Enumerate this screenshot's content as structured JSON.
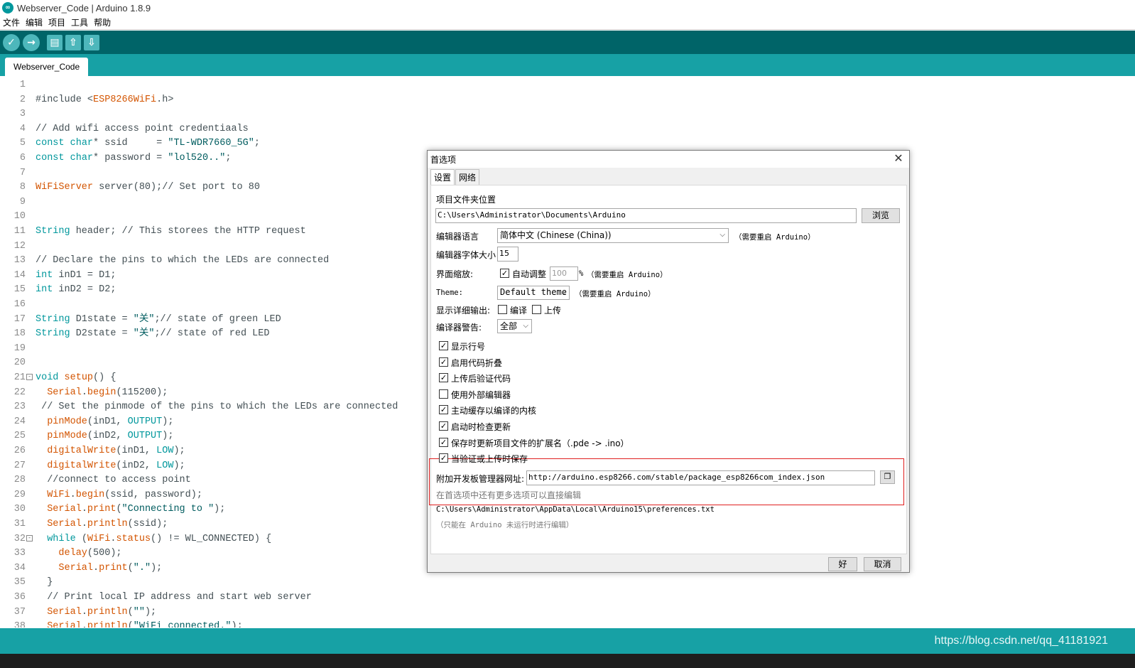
{
  "window": {
    "title": "Webserver_Code | Arduino 1.8.9",
    "icon": "arduino-logo-icon"
  },
  "menu": [
    "文件",
    "编辑",
    "项目",
    "工具",
    "帮助"
  ],
  "toolbar": {
    "buttons": [
      {
        "name": "verify-button",
        "icon": "check-icon",
        "glyph": "✓"
      },
      {
        "name": "upload-button",
        "icon": "arrow-right-icon",
        "glyph": "→"
      },
      {
        "name": "new-button",
        "icon": "file-icon",
        "glyph": "▤"
      },
      {
        "name": "open-button",
        "icon": "arrow-up-icon",
        "glyph": "⇧"
      },
      {
        "name": "save-button",
        "icon": "arrow-down-icon",
        "glyph": "⇩"
      }
    ]
  },
  "tab": {
    "label": "Webserver_Code"
  },
  "code_lines": [
    {
      "n": "1",
      "html": ""
    },
    {
      "n": "2",
      "html": "#include &lt;<span class='fn'>ESP8266WiFi</span>.h&gt;"
    },
    {
      "n": "3",
      "html": ""
    },
    {
      "n": "4",
      "html": "// Add wifi access point credentiaals"
    },
    {
      "n": "5",
      "html": "<span class='kw'>const</span> <span class='kw'>char</span>* ssid     = <span class='str'>\"TL-WDR7660_5G\"</span>;"
    },
    {
      "n": "6",
      "html": "<span class='kw'>const</span> <span class='kw'>char</span>* password = <span class='str'>\"lol520..\"</span>;"
    },
    {
      "n": "7",
      "html": ""
    },
    {
      "n": "8",
      "html": "<span class='fn'>WiFiServer</span> server(80);// Set port to 80"
    },
    {
      "n": "9",
      "html": ""
    },
    {
      "n": "10",
      "html": ""
    },
    {
      "n": "11",
      "html": "<span class='kw'>String</span> header; // This storees the HTTP request"
    },
    {
      "n": "12",
      "html": ""
    },
    {
      "n": "13",
      "html": "// Declare the pins to which the LEDs are connected"
    },
    {
      "n": "14",
      "html": "<span class='kw'>int</span> inD1 = D1;"
    },
    {
      "n": "15",
      "html": "<span class='kw'>int</span> inD2 = D2;"
    },
    {
      "n": "16",
      "html": ""
    },
    {
      "n": "17",
      "html": "<span class='kw'>String</span> D1state = <span class='str'>\"关\"</span>;// state of green LED"
    },
    {
      "n": "18",
      "html": "<span class='kw'>String</span> D2state = <span class='str'>\"关\"</span>;// state of red LED"
    },
    {
      "n": "19",
      "html": ""
    },
    {
      "n": "20",
      "html": ""
    },
    {
      "n": "21",
      "html": "<span class='kw'>void</span> <span class='fn'>setup</span>() {",
      "fold": "⊟"
    },
    {
      "n": "22",
      "html": "  <span class='fn'>Serial</span>.<span class='fn'>begin</span>(115200);"
    },
    {
      "n": "23",
      "html": " // Set the pinmode of the pins to which the LEDs are connected"
    },
    {
      "n": "24",
      "html": "  <span class='fn'>pinMode</span>(inD1, <span class='cst'>OUTPUT</span>);"
    },
    {
      "n": "25",
      "html": "  <span class='fn'>pinMode</span>(inD2, <span class='cst'>OUTPUT</span>);"
    },
    {
      "n": "26",
      "html": "  <span class='fn'>digitalWrite</span>(inD1, <span class='cst'>LOW</span>);"
    },
    {
      "n": "27",
      "html": "  <span class='fn'>digitalWrite</span>(inD2, <span class='cst'>LOW</span>);"
    },
    {
      "n": "28",
      "html": "  //connect to access point"
    },
    {
      "n": "29",
      "html": "  <span class='fn'>WiFi</span>.<span class='fn'>begin</span>(ssid, password);"
    },
    {
      "n": "30",
      "html": "  <span class='fn'>Serial</span>.<span class='fn'>print</span>(<span class='str'>\"Connecting to \"</span>);"
    },
    {
      "n": "31",
      "html": "  <span class='fn'>Serial</span>.<span class='fn'>println</span>(ssid);"
    },
    {
      "n": "32",
      "html": "  <span class='kw'>while</span> (<span class='fn'>WiFi</span>.<span class='fn'>status</span>() != WL_CONNECTED) {",
      "fold": "⊟"
    },
    {
      "n": "33",
      "html": "    <span class='fn'>delay</span>(500);"
    },
    {
      "n": "34",
      "html": "    <span class='fn'>Serial</span>.<span class='fn'>print</span>(<span class='str'>\".\"</span>);"
    },
    {
      "n": "35",
      "html": "  }"
    },
    {
      "n": "36",
      "html": "  // Print local IP address and start web server"
    },
    {
      "n": "37",
      "html": "  <span class='fn'>Serial</span>.<span class='fn'>println</span>(<span class='str'>\"\"</span>);"
    },
    {
      "n": "38",
      "html": "  <span class='fn'>Serial</span>.<span class='fn'>println</span>(<span class='str'>\"WiFi connected.\"</span>);"
    }
  ],
  "dialog": {
    "title": "首选项",
    "close": "✕",
    "tabs": [
      "设置",
      "网络"
    ],
    "sketchbook_label": "项目文件夹位置",
    "sketchbook_path": "C:\\Users\\Administrator\\Documents\\Arduino",
    "browse": "浏览",
    "language_label": "编辑器语言",
    "language_value": "简体中文 (Chinese (China))",
    "restart_note": "（需要重启 Arduino）",
    "font_size_label": "编辑器字体大小",
    "font_size_value": "15",
    "scale_label": "界面缩放:",
    "scale_auto": "自动调整",
    "scale_value": "100",
    "scale_unit": "%",
    "scale_note": "（需要重启 Arduino）",
    "theme_label": "Theme:",
    "theme_value": "Default theme",
    "theme_note": "（需要重启 Arduino）",
    "verbose_label": "显示详细输出:",
    "verbose_compile": "编译",
    "verbose_upload": "上传",
    "warnings_label": "编译器警告:",
    "warnings_value": "全部",
    "checkboxes": [
      {
        "label": "显示行号",
        "checked": true
      },
      {
        "label": "启用代码折叠",
        "checked": true
      },
      {
        "label": "上传后验证代码",
        "checked": true
      },
      {
        "label": "使用外部编辑器",
        "checked": false
      },
      {
        "label": "主动缓存以编译的内核",
        "checked": true
      },
      {
        "label": "启动时检查更新",
        "checked": true
      },
      {
        "label": "保存时更新项目文件的扩展名（.pde -> .ino）",
        "checked": true
      },
      {
        "label": "当验证或上传时保存",
        "checked": true
      }
    ],
    "boards_url_label": "附加开发板管理器网址:",
    "boards_url_value": "http://arduino.esp8266.com/stable/package_esp8266com_index.json",
    "more_options": "在首选项中还有更多选项可以直接编辑",
    "prefs_path": "C:\\Users\\Administrator\\AppData\\Local\\Arduino15\\preferences.txt",
    "prefs_note": "（只能在 Arduino 未运行时进行编辑）",
    "ok": "好",
    "cancel": "取消"
  },
  "watermark": "https://blog.csdn.net/qq_41181921"
}
